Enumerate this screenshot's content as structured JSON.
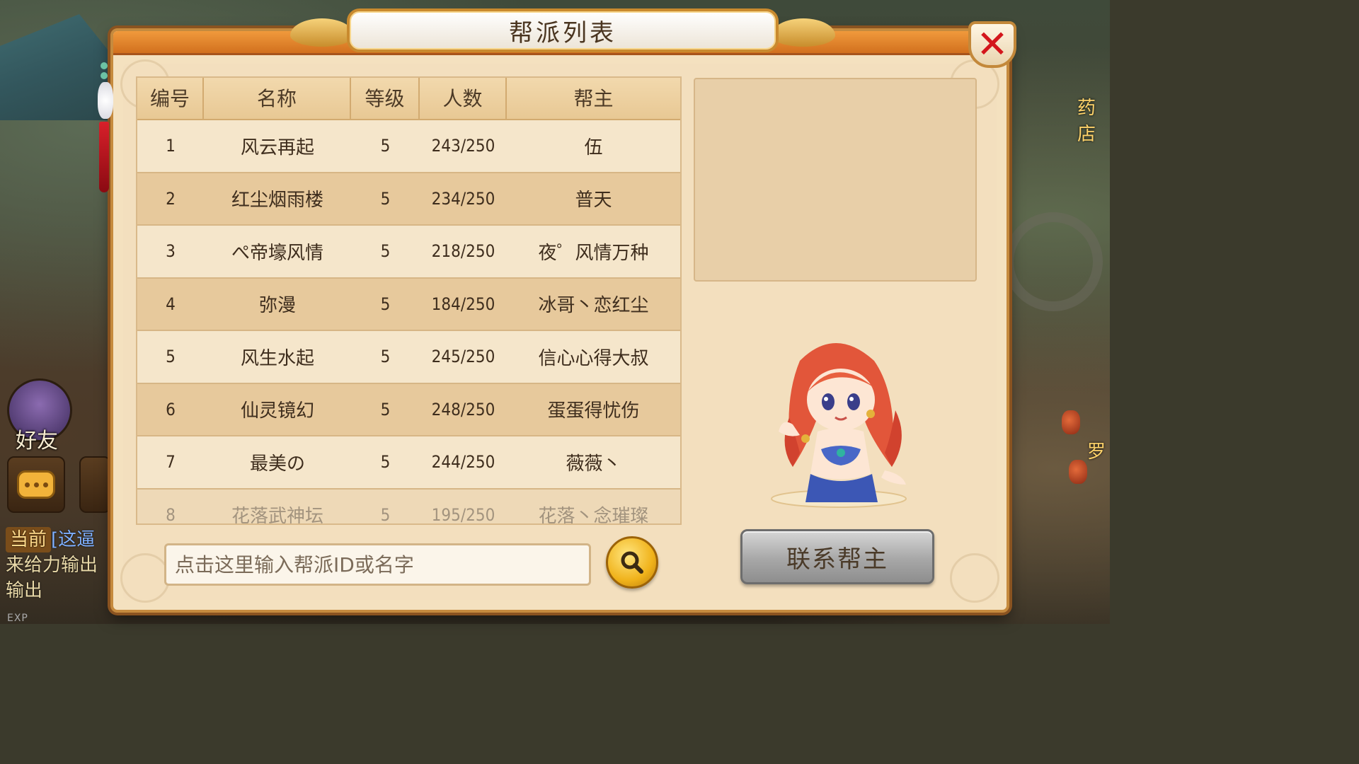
{
  "dialog": {
    "title": "帮派列表",
    "close_icon": "close-x-icon"
  },
  "table": {
    "headers": [
      "编号",
      "名称",
      "等级",
      "人数",
      "帮主"
    ],
    "rows": [
      {
        "id": "1",
        "name": "风云再起",
        "level": "5",
        "members": "243/250",
        "leader": "伍"
      },
      {
        "id": "2",
        "name": "红尘烟雨楼",
        "level": "5",
        "members": "234/250",
        "leader": "普天"
      },
      {
        "id": "3",
        "name": "ぺ帝壕风情",
        "level": "5",
        "members": "218/250",
        "leader": "夜゜风情万种"
      },
      {
        "id": "4",
        "name": "弥漫",
        "level": "5",
        "members": "184/250",
        "leader": "冰哥丶恋红尘"
      },
      {
        "id": "5",
        "name": "风生水起",
        "level": "5",
        "members": "245/250",
        "leader": "信心心得大叔"
      },
      {
        "id": "6",
        "name": "仙灵镜幻",
        "level": "5",
        "members": "248/250",
        "leader": "蛋蛋得忧伤"
      },
      {
        "id": "7",
        "name": "最美の",
        "level": "5",
        "members": "244/250",
        "leader": "薇薇丶"
      },
      {
        "id": "8",
        "name": "花落武神坛",
        "level": "5",
        "members": "195/250",
        "leader": "花落丶念璀璨"
      }
    ]
  },
  "search": {
    "placeholder": "点击这里输入帮派ID或名字",
    "icon": "search-icon"
  },
  "contact_button": {
    "label": "联系帮主"
  },
  "hud": {
    "friend_label": "好友",
    "chat_current": "当前",
    "chat_channel": "[这逼",
    "chat_line2": "来给力输出",
    "chat_line3": "输出",
    "exp_label": "EXP",
    "right_text_1": "药店",
    "right_text_2": "罗"
  },
  "colors": {
    "frame_orange": "#e07f28",
    "panel_bg": "#f4e1bf",
    "close_red": "#d3161c",
    "search_gold": "#f0b21a"
  }
}
